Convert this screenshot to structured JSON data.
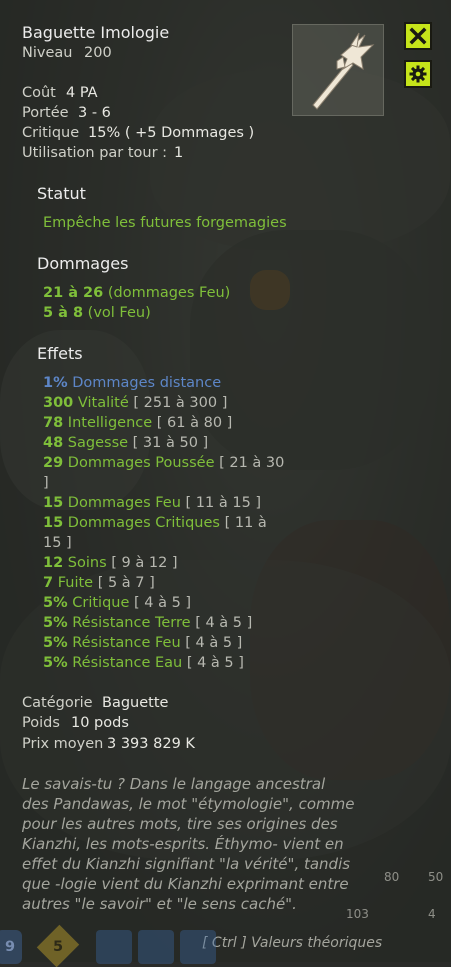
{
  "item": {
    "name": "Baguette Imologie",
    "level_label": "Niveau",
    "level": "200"
  },
  "stats": {
    "cost_label": "Coût",
    "cost_value": "4 PA",
    "range_label": "Portée",
    "range_value": "3 - 6",
    "crit_label": "Critique",
    "crit_value": "15% ( +5 Dommages )",
    "uses_label": "Utilisation par tour :",
    "uses_value": "1"
  },
  "status": {
    "title": "Statut",
    "text": "Empêche les futures forgemagies"
  },
  "damages": {
    "title": "Dommages",
    "lines": [
      {
        "value": "21 à 26",
        "desc": "(dommages Feu)"
      },
      {
        "value": "5 à 8",
        "desc": "(vol Feu)"
      }
    ]
  },
  "effects": {
    "title": "Effets",
    "lines": [
      {
        "value": "1%",
        "desc": "Dommages distance",
        "range": "",
        "color": "blue"
      },
      {
        "value": "300",
        "desc": "Vitalité",
        "range": "[ 251 à 300 ]",
        "color": "green"
      },
      {
        "value": "78",
        "desc": "Intelligence",
        "range": "[ 61 à 80 ]",
        "color": "green"
      },
      {
        "value": "48",
        "desc": "Sagesse",
        "range": "[ 31 à 50 ]",
        "color": "green"
      },
      {
        "value": "29",
        "desc": "Dommages Poussée",
        "range": "[ 21 à 30",
        "color": "green"
      },
      {
        "value": "",
        "desc": "",
        "range": "]",
        "color": "green"
      },
      {
        "value": "15",
        "desc": "Dommages Feu",
        "range": "[ 11 à 15 ]",
        "color": "green"
      },
      {
        "value": "15",
        "desc": "Dommages Critiques",
        "range": "[ 11 à",
        "color": "green"
      },
      {
        "value": "",
        "desc": "",
        "range": "15 ]",
        "color": "green"
      },
      {
        "value": "12",
        "desc": "Soins",
        "range": "[ 9 à 12 ]",
        "color": "green"
      },
      {
        "value": "7",
        "desc": "Fuite",
        "range": "[ 5 à 7 ]",
        "color": "green"
      },
      {
        "value": "5%",
        "desc": "Critique",
        "range": "[ 4 à 5 ]",
        "color": "green"
      },
      {
        "value": "5%",
        "desc": "Résistance Terre",
        "range": "[ 4 à 5 ]",
        "color": "green"
      },
      {
        "value": "5%",
        "desc": "Résistance Feu",
        "range": "[ 4 à 5 ]",
        "color": "green"
      },
      {
        "value": "5%",
        "desc": "Résistance Eau",
        "range": "[ 4 à 5 ]",
        "color": "green"
      }
    ]
  },
  "info": {
    "category_label": "Catégorie",
    "category_value": "Baguette",
    "weight_label": "Poids",
    "weight_value": "10 pods",
    "price_label": "Prix moyen",
    "price_value": "3 393 829 K"
  },
  "lore": [
    "Le savais-tu ? Dans le langage ancestral",
    "des Pandawas, le mot \"étymologie\", comme",
    "pour les autres mots, tire ses origines des",
    "Kianzhi, les mots-esprits. Éthymo- vient en",
    "effet du Kianzhi signifiant \"la vérité\", tandis",
    "que -logie vient du Kianzhi exprimant entre",
    "autres \"le savoir\" et \"le sens caché\"."
  ],
  "footer_hint": "[ Ctrl ] Valeurs théoriques",
  "hud": {
    "left_number": "9",
    "badge_number": "5",
    "counter_a": "80",
    "counter_b": "50",
    "counter_c": "103",
    "counter_d": "4"
  },
  "colors": {
    "accent_green": "#7fbf3a",
    "accent_blue": "#5d86c7",
    "button_yellow": "#c6e41a"
  }
}
